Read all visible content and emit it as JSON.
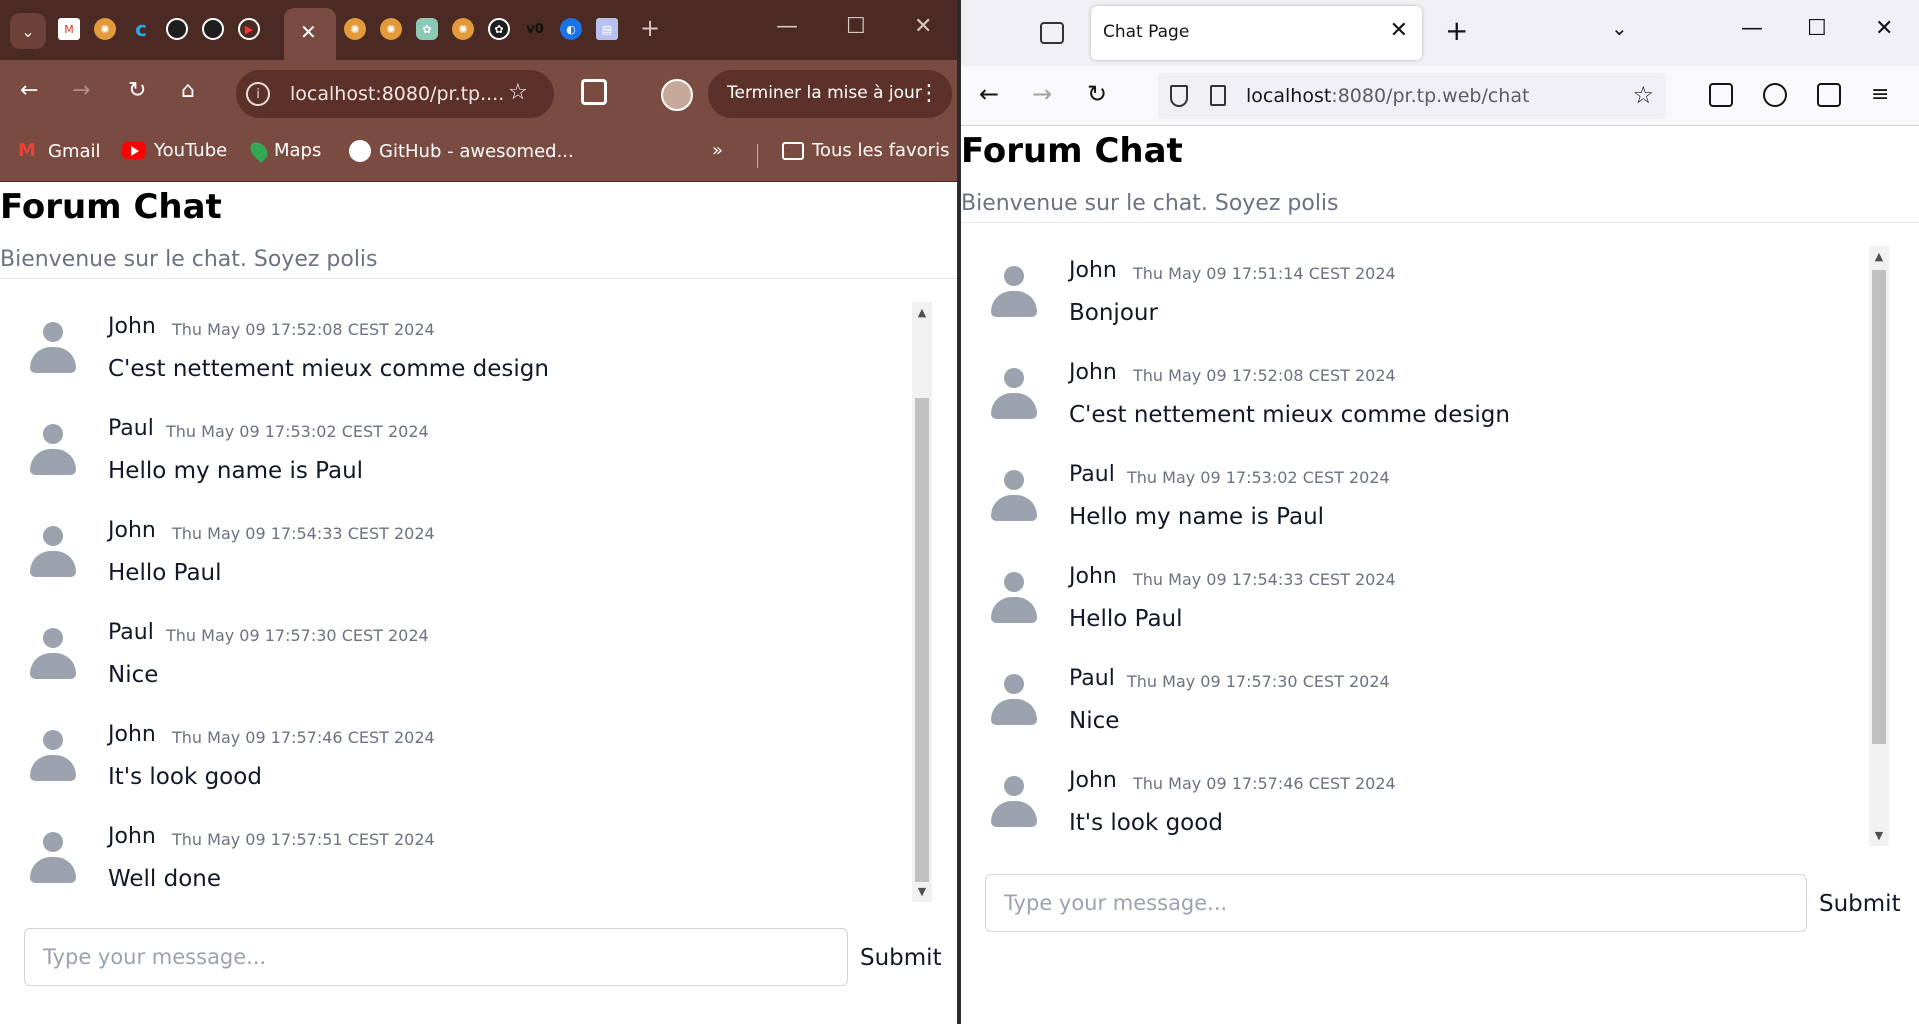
{
  "chrome": {
    "tabs_active_close": "✕",
    "new_tab": "+",
    "url": "localhost:8080/pr.tp....",
    "update_button": "Terminer la mise à jour",
    "bookmarks": [
      "Gmail",
      "YouTube",
      "Maps",
      "GitHub - awesomed...",
      "Tous les favoris"
    ],
    "page": {
      "title": "Forum Chat",
      "subtitle": "Bienvenue sur le chat. Soyez polis",
      "messages": [
        {
          "author": "John",
          "time": "Thu May 09 17:52:08 CEST 2024",
          "text": "C'est nettement mieux comme design"
        },
        {
          "author": "Paul",
          "time": "Thu May 09 17:53:02 CEST 2024",
          "text": "Hello my name is Paul"
        },
        {
          "author": "John",
          "time": "Thu May 09 17:54:33 CEST 2024",
          "text": "Hello Paul"
        },
        {
          "author": "Paul",
          "time": "Thu May 09 17:57:30 CEST 2024",
          "text": "Nice"
        },
        {
          "author": "John",
          "time": "Thu May 09 17:57:46 CEST 2024",
          "text": "It's look good"
        },
        {
          "author": "John",
          "time": "Thu May 09 17:57:51 CEST 2024",
          "text": "Well done"
        }
      ],
      "input_placeholder": "Type your message...",
      "submit_label": "Submit"
    }
  },
  "firefox": {
    "tab_title": "Chat Page",
    "new_tab": "+",
    "url_host": "localhost",
    "url_rest": ":8080/pr.tp.web/chat",
    "page": {
      "title": "Forum Chat",
      "subtitle": "Bienvenue sur le chat. Soyez polis",
      "messages": [
        {
          "author": "John",
          "time": "Thu May 09 17:51:14 CEST 2024",
          "text": "Bonjour"
        },
        {
          "author": "John",
          "time": "Thu May 09 17:52:08 CEST 2024",
          "text": "C'est nettement mieux comme design"
        },
        {
          "author": "Paul",
          "time": "Thu May 09 17:53:02 CEST 2024",
          "text": "Hello my name is Paul"
        },
        {
          "author": "John",
          "time": "Thu May 09 17:54:33 CEST 2024",
          "text": "Hello Paul"
        },
        {
          "author": "Paul",
          "time": "Thu May 09 17:57:30 CEST 2024",
          "text": "Nice"
        },
        {
          "author": "John",
          "time": "Thu May 09 17:57:46 CEST 2024",
          "text": "It's look good"
        }
      ],
      "input_placeholder": "Type your message...",
      "submit_label": "Submit"
    }
  }
}
